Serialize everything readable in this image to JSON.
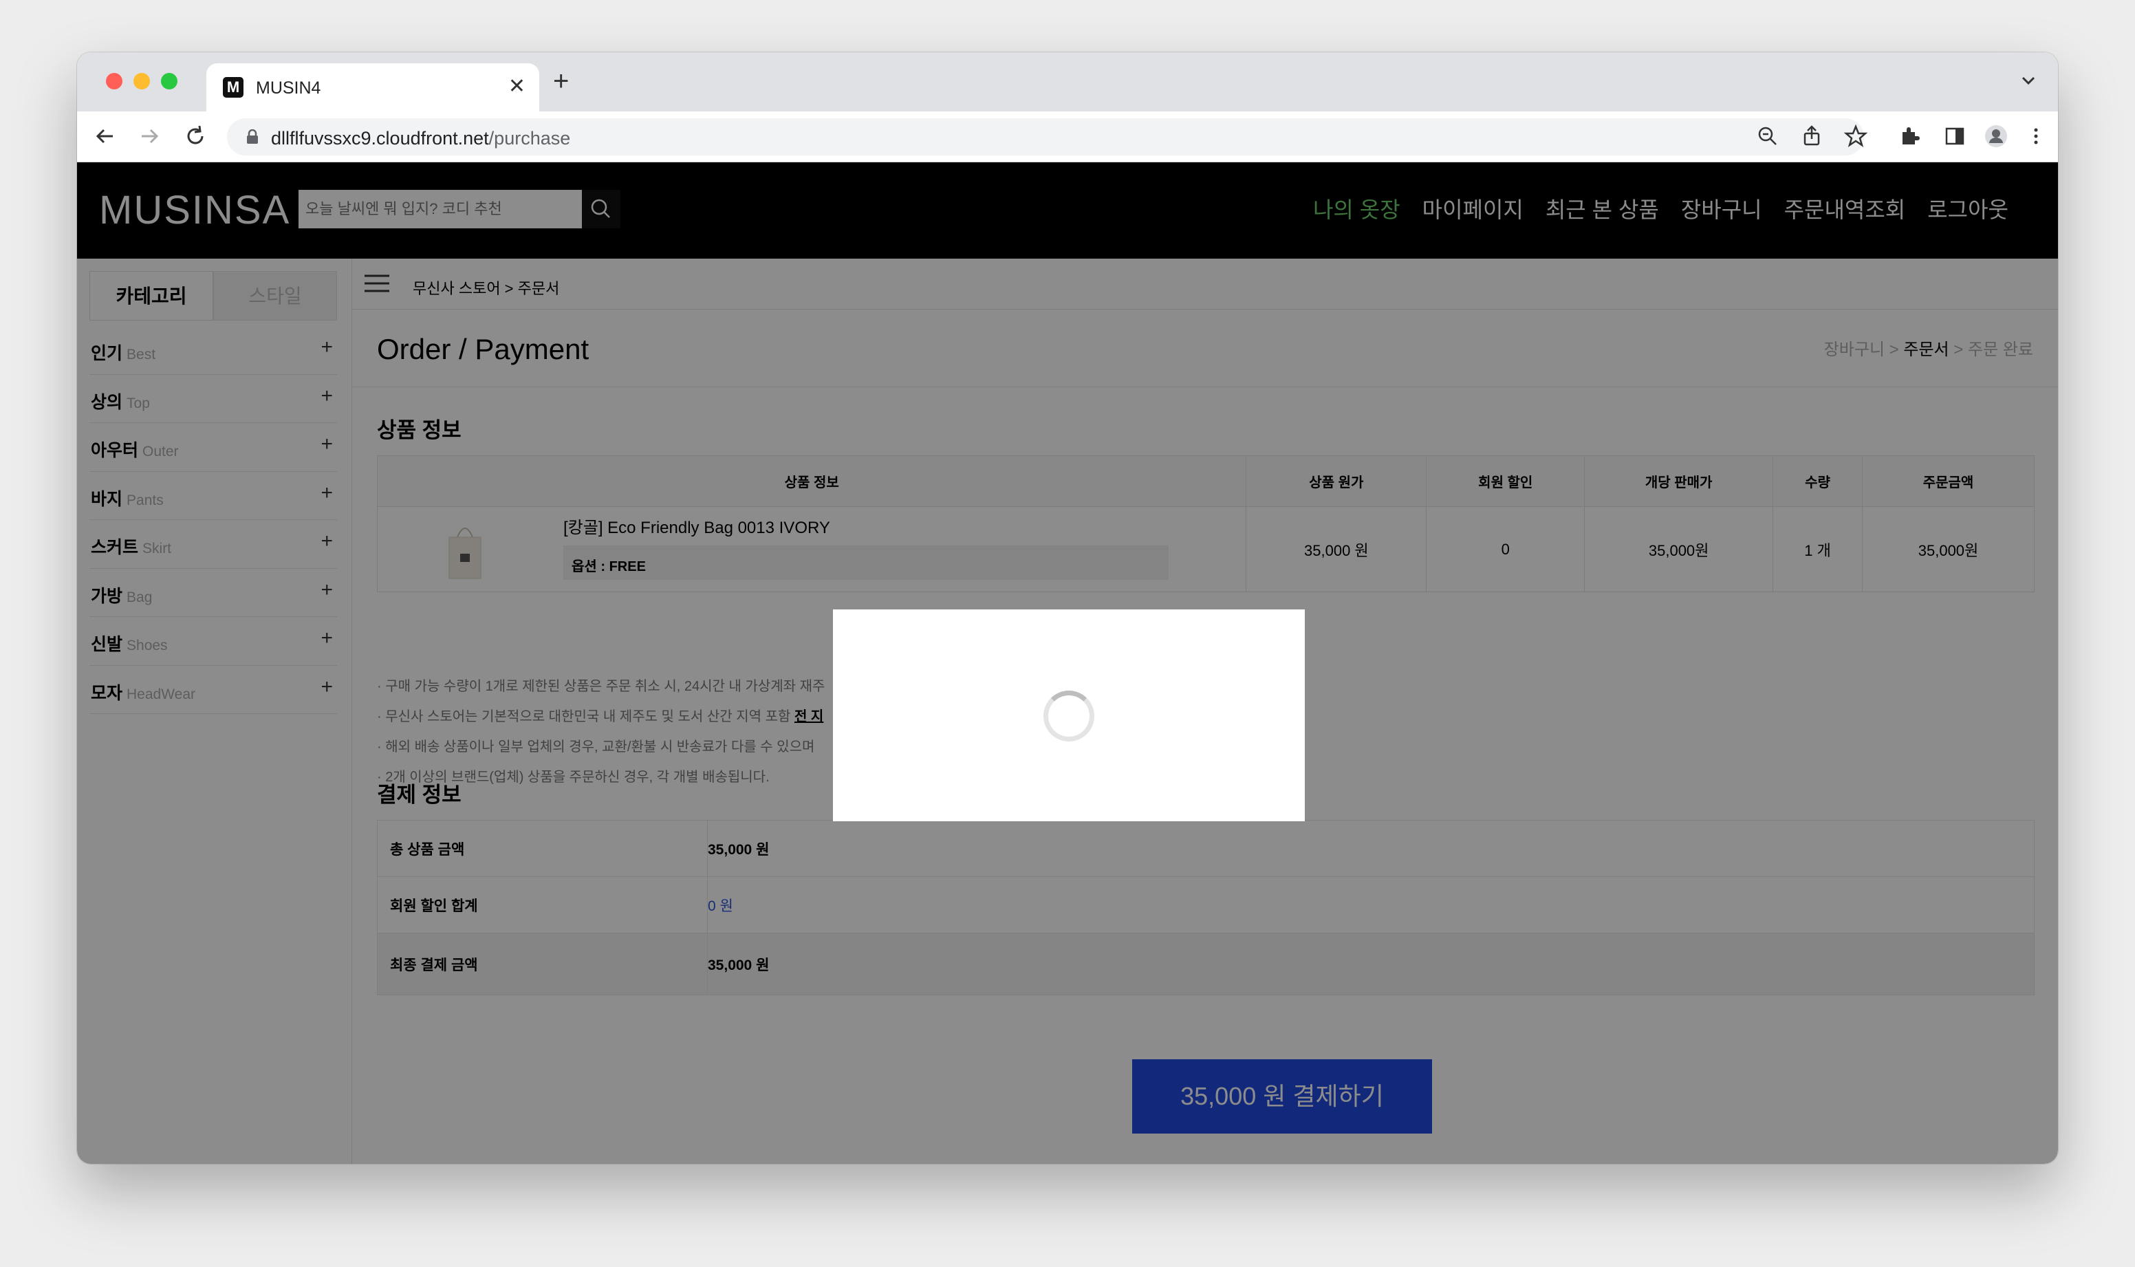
{
  "browser": {
    "tab_title": "MUSIN4",
    "favicon_letter": "M",
    "url_host": "dllflfuvssxc9.cloudfront.net",
    "url_path": "/purchase"
  },
  "header": {
    "logo": "MUSINSA",
    "search_placeholder": "오늘 날씨엔 뭐 입지? 코디 추천",
    "nav": [
      "나의 옷장",
      "마이페이지",
      "최근 본 상품",
      "장바구니",
      "주문내역조회",
      "로그아웃"
    ],
    "active_color": "#6fd36f"
  },
  "sidebar": {
    "tabs": [
      "카테고리",
      "스타일"
    ],
    "categories": [
      {
        "ko": "인기",
        "en": "Best"
      },
      {
        "ko": "상의",
        "en": "Top"
      },
      {
        "ko": "아우터",
        "en": "Outer"
      },
      {
        "ko": "바지",
        "en": "Pants"
      },
      {
        "ko": "스커트",
        "en": "Skirt"
      },
      {
        "ko": "가방",
        "en": "Bag"
      },
      {
        "ko": "신발",
        "en": "Shoes"
      },
      {
        "ko": "모자",
        "en": "HeadWear"
      }
    ]
  },
  "main": {
    "breadcrumb": "무신사 스토어 > 주문서",
    "title": "Order / Payment",
    "steps": [
      "장바구니",
      "주문서",
      "주문 완료"
    ],
    "product_section_title": "상품 정보",
    "table_headers": [
      "상품 정보",
      "상품 원가",
      "회원 할인",
      "개당 판매가",
      "수량",
      "주문금액"
    ],
    "product": {
      "name": "[캉골] Eco Friendly Bag 0013 IVORY",
      "option": "옵션 : FREE",
      "price": "35,000 원",
      "discount": "0",
      "unit_price": "35,000원",
      "qty": "1 개",
      "total": "35,000원"
    },
    "notes": [
      "· 구매 가능 수량이 1개로 제한된 상품은 주문 취소 시, 24시간 내 가상계좌 재주",
      "· 무신사 스토어는 기본적으로 대한민국 내 제주도 및 도서 산간 지역 포함",
      "· 해외 배송 상품이나 일부 업체의 경우, 교환/환불 시 반송료가 다를 수 있으며",
      "· 2개 이상의 브랜드(업체) 상품을 주문하신 경우, 각 개별 배송됩니다."
    ],
    "notes_emph": "전 지",
    "payment_section_title": "결제 정보",
    "payment_rows": [
      {
        "label": "총 상품 금액",
        "value": "35,000 원"
      },
      {
        "label": "회원 할인 합계",
        "value": "0 원"
      },
      {
        "label": "최종 결제 금액",
        "value": "35,000 원"
      }
    ],
    "pay_button": "35,000 원 결제하기",
    "accent_color": "#1f49e0"
  },
  "loading_modal": {
    "state": "loading"
  }
}
